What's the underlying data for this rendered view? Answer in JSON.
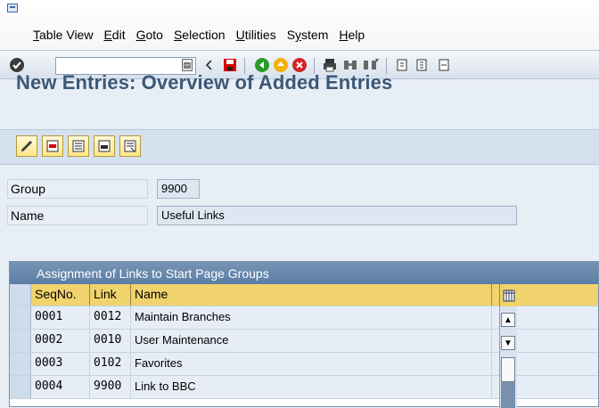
{
  "menu": {
    "items": [
      {
        "label": "Table View",
        "underline_char": "T"
      },
      {
        "label": "Edit",
        "underline_char": "E"
      },
      {
        "label": "Goto",
        "underline_char": "G"
      },
      {
        "label": "Selection",
        "underline_char": "S"
      },
      {
        "label": "Utilities",
        "underline_char": "U"
      },
      {
        "label": "System",
        "underline_char": "y"
      },
      {
        "label": "Help",
        "underline_char": "H"
      }
    ]
  },
  "toolbar": {
    "command_field_value": "",
    "icons": [
      "enter-icon",
      "command-dropdown-icon",
      "back-arrow-icon",
      "save-icon",
      "back-icon",
      "exit-icon",
      "cancel-icon",
      "print-icon",
      "find-icon",
      "find-next-icon",
      "first-page-icon",
      "previous-page-icon"
    ]
  },
  "page": {
    "title": "New Entries: Overview of Added Entries"
  },
  "app_toolbar": {
    "icons": [
      "change-icon",
      "delete-icon",
      "select-all-icon",
      "select-block-icon",
      "deselect-all-icon"
    ]
  },
  "form": {
    "group_label": "Group",
    "group_value": "9900",
    "name_label": "Name",
    "name_value": "Useful Links"
  },
  "table": {
    "title": "Assignment of Links to Start Page Groups",
    "headers": {
      "seqno": "SeqNo.",
      "link": "Link",
      "name": "Name"
    },
    "rows": [
      {
        "seqno": "0001",
        "link": "0012",
        "name": "Maintain Branches"
      },
      {
        "seqno": "0002",
        "link": "0010",
        "name": "User Maintenance"
      },
      {
        "seqno": "0003",
        "link": "0102",
        "name": "Favorites"
      },
      {
        "seqno": "0004",
        "link": "9900",
        "name": "Link to BBC"
      }
    ]
  },
  "colors": {
    "title": "#3b5878",
    "header": "#f0d36d",
    "table_bar": "#6687ad",
    "background": "#e8eef5"
  }
}
